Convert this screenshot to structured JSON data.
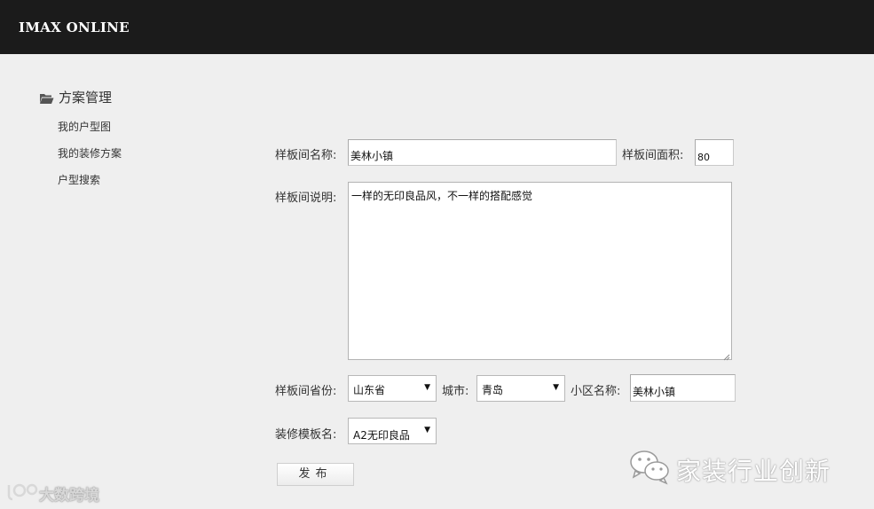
{
  "header": {
    "brand": "IMAX ONLINE"
  },
  "sidebar": {
    "title": "方案管理",
    "items": [
      {
        "label": "我的户型图"
      },
      {
        "label": "我的装修方案"
      },
      {
        "label": "户型搜索"
      }
    ]
  },
  "form": {
    "room_name_label": "样板间名称:",
    "room_name_value": "美林小镇",
    "room_area_label": "样板间面积:",
    "room_area_value": "80",
    "room_desc_label": "样板间说明:",
    "room_desc_value": "一样的无印良品风，不一样的搭配感觉",
    "province_label": "样板间省份:",
    "province_value": "山东省",
    "city_label": "城市:",
    "city_value": "青岛",
    "community_label": "小区名称:",
    "community_value": "美林小镇",
    "template_label": "装修模板名:",
    "template_value": "A2无印良品",
    "publish_label": "发布"
  },
  "watermarks": {
    "left": "大数跨境",
    "right": "家装行业创新"
  }
}
